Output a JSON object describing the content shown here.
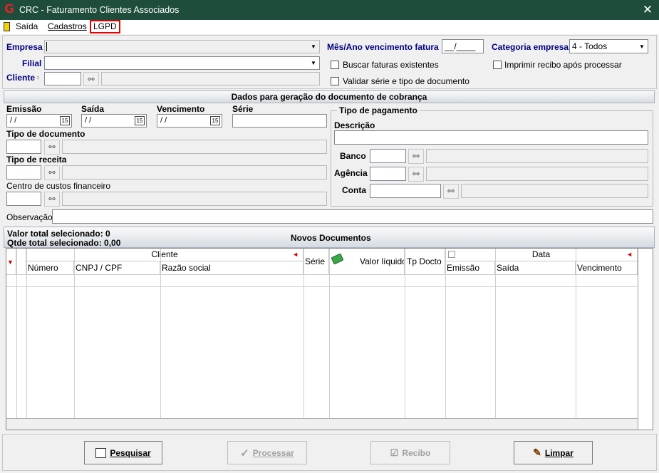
{
  "window": {
    "title": "CRC - Faturamento Clientes Associados",
    "logo": "G"
  },
  "menu": {
    "saida": "Saída",
    "cadastros": "Cadastros",
    "lgpd": "LGPD"
  },
  "header": {
    "empresa": "Empresa",
    "filial": "Filial",
    "cliente": "Cliente",
    "mes_ano_label": "Mês/Ano vencimento fatura",
    "mes_ano_value": "__/____",
    "categoria_label": "Categoria empresa",
    "categoria_value": "4 - Todos",
    "buscar_faturas": "Buscar faturas existentes",
    "imprimir_recibo": "Imprimir recibo após processar",
    "validar_serie": "Validar série e tipo de documento"
  },
  "dados": {
    "title": "Dados para geração do documento de cobrança",
    "emissao": "Emissão",
    "saida": "Saída",
    "vencimento": "Vencimento",
    "serie": "Série",
    "date_placeholder": "/ /",
    "cal_day": "15",
    "tipo_documento": "Tipo de documento",
    "tipo_receita": "Tipo de receita",
    "centro_custos": "Centro de custos financeiro",
    "observacao": "Observação"
  },
  "pagamento": {
    "title": "Tipo de pagamento",
    "descricao": "Descrição",
    "banco": "Banco",
    "agencia": "Agência",
    "conta": "Conta"
  },
  "summary": {
    "valor_total": "Valor total selecionado: 0",
    "qtde_total": "Qtde total selecionado: 0,00",
    "title": "Novos Documentos"
  },
  "grid": {
    "group_cliente": "Cliente",
    "group_data": "Data",
    "col_numero": "Número",
    "col_cnpj": "CNPJ / CPF",
    "col_razao": "Razão social",
    "col_serie": "Série",
    "col_valor": "Valor líquido",
    "col_tpdocto": "Tp Docto",
    "col_emissao": "Emissão",
    "col_saida": "Saída",
    "col_vencimento": "Vencimento"
  },
  "buttons": {
    "pesquisar": "Pesquisar",
    "processar": "Processar",
    "recibo": "Recibo",
    "limpar": "Limpar"
  },
  "icons": {
    "close": "close-icon",
    "lookup": "binoculars-icon",
    "calendar": "calendar-icon",
    "money": "money-icon"
  }
}
